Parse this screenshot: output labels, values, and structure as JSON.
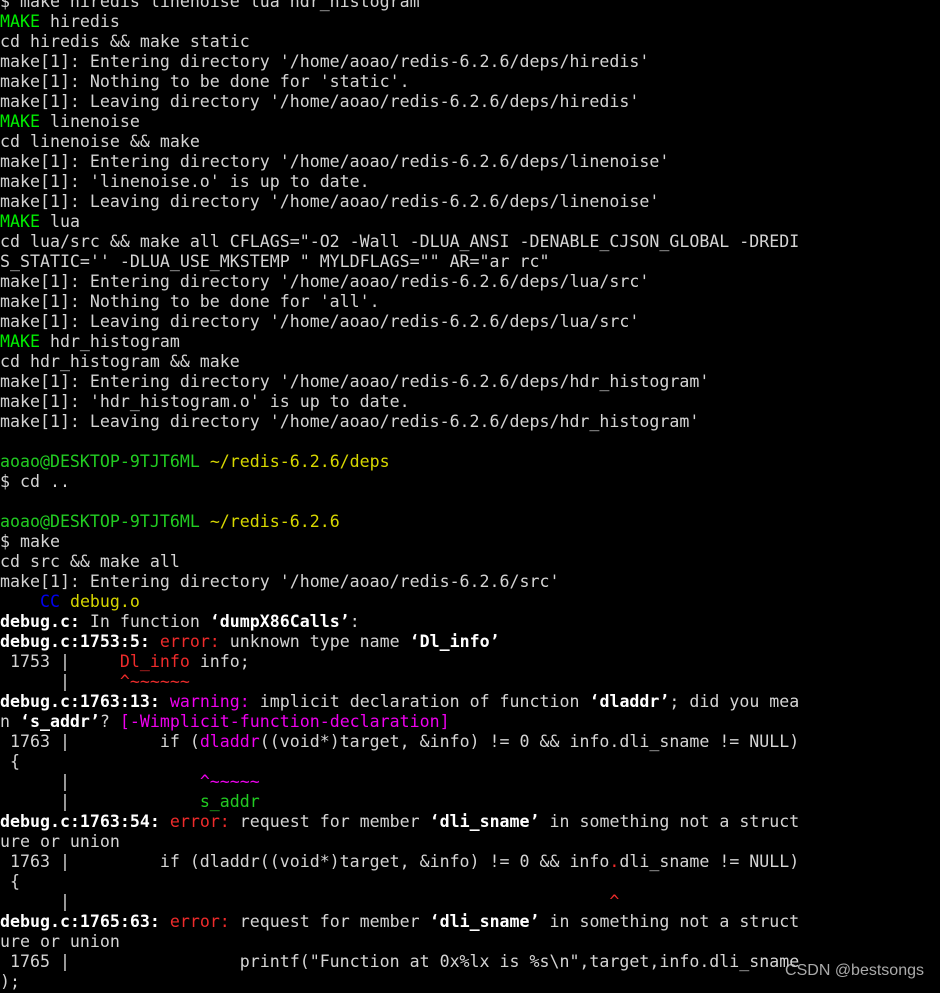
{
  "lines": [
    [
      {
        "t": "$ make hiredis linenoise lua hdr_histogram"
      }
    ],
    [
      {
        "t": "MAKE",
        "c": "g"
      },
      {
        "t": " hiredis"
      }
    ],
    [
      {
        "t": "cd hiredis && make static"
      }
    ],
    [
      {
        "t": "make[1]: Entering directory '/home/aoao/redis-6.2.6/deps/hiredis'"
      }
    ],
    [
      {
        "t": "make[1]: Nothing to be done for 'static'."
      }
    ],
    [
      {
        "t": "make[1]: Leaving directory '/home/aoao/redis-6.2.6/deps/hiredis'"
      }
    ],
    [
      {
        "t": "MAKE",
        "c": "g"
      },
      {
        "t": " linenoise"
      }
    ],
    [
      {
        "t": "cd linenoise && make"
      }
    ],
    [
      {
        "t": "make[1]: Entering directory '/home/aoao/redis-6.2.6/deps/linenoise'"
      }
    ],
    [
      {
        "t": "make[1]: 'linenoise.o' is up to date."
      }
    ],
    [
      {
        "t": "make[1]: Leaving directory '/home/aoao/redis-6.2.6/deps/linenoise'"
      }
    ],
    [
      {
        "t": "MAKE",
        "c": "g"
      },
      {
        "t": " lua"
      }
    ],
    [
      {
        "t": "cd lua/src && make all CFLAGS=\"-O2 -Wall -DLUA_ANSI -DENABLE_CJSON_GLOBAL -DREDI"
      }
    ],
    [
      {
        "t": "S_STATIC='' -DLUA_USE_MKSTEMP \" MYLDFLAGS=\"\" AR=\"ar rc\""
      }
    ],
    [
      {
        "t": "make[1]: Entering directory '/home/aoao/redis-6.2.6/deps/lua/src'"
      }
    ],
    [
      {
        "t": "make[1]: Nothing to be done for 'all'."
      }
    ],
    [
      {
        "t": "make[1]: Leaving directory '/home/aoao/redis-6.2.6/deps/lua/src'"
      }
    ],
    [
      {
        "t": "MAKE",
        "c": "g"
      },
      {
        "t": " hdr_histogram"
      }
    ],
    [
      {
        "t": "cd hdr_histogram && make"
      }
    ],
    [
      {
        "t": "make[1]: Entering directory '/home/aoao/redis-6.2.6/deps/hdr_histogram'"
      }
    ],
    [
      {
        "t": "make[1]: 'hdr_histogram.o' is up to date."
      }
    ],
    [
      {
        "t": "make[1]: Leaving directory '/home/aoao/redis-6.2.6/deps/hdr_histogram'"
      }
    ],
    [
      {
        "t": ""
      }
    ],
    [
      {
        "t": "aoao@DESKTOP-9TJT6ML",
        "c": "gr"
      },
      {
        "t": " "
      },
      {
        "t": "~/redis-6.2.6/deps",
        "c": "y"
      }
    ],
    [
      {
        "t": "$ cd .."
      }
    ],
    [
      {
        "t": ""
      }
    ],
    [
      {
        "t": "aoao@DESKTOP-9TJT6ML",
        "c": "gr"
      },
      {
        "t": " "
      },
      {
        "t": "~/redis-6.2.6",
        "c": "y"
      }
    ],
    [
      {
        "t": "$ make"
      }
    ],
    [
      {
        "t": "cd src && make all"
      }
    ],
    [
      {
        "t": "make[1]: Entering directory '/home/aoao/redis-6.2.6/src'"
      }
    ],
    [
      {
        "t": "    "
      },
      {
        "t": "CC",
        "c": "b"
      },
      {
        "t": " "
      },
      {
        "t": "debug.o",
        "c": "y"
      }
    ],
    [
      {
        "t": "debug.c:",
        "c": "bold"
      },
      {
        "t": " In function "
      },
      {
        "t": "‘dumpX86Calls’",
        "c": "bold"
      },
      {
        "t": ":"
      }
    ],
    [
      {
        "t": "debug.c:1753:5:",
        "c": "bold"
      },
      {
        "t": " "
      },
      {
        "t": "error:",
        "c": "r"
      },
      {
        "t": " unknown type name "
      },
      {
        "t": "‘Dl_info’",
        "c": "bold"
      }
    ],
    [
      {
        "t": " 1753 |     "
      },
      {
        "t": "Dl_info",
        "c": "r"
      },
      {
        "t": " info;"
      }
    ],
    [
      {
        "t": "      |     "
      },
      {
        "t": "^~~~~~~",
        "c": "r"
      }
    ],
    [
      {
        "t": "debug.c:1763:13:",
        "c": "bold"
      },
      {
        "t": " "
      },
      {
        "t": "warning:",
        "c": "m"
      },
      {
        "t": " implicit declaration of function "
      },
      {
        "t": "‘dladdr’",
        "c": "bold"
      },
      {
        "t": "; did you mea"
      }
    ],
    [
      {
        "t": "n "
      },
      {
        "t": "‘s_addr’",
        "c": "bold"
      },
      {
        "t": "? "
      },
      {
        "t": "[-Wimplicit-function-declaration]",
        "c": "m"
      }
    ],
    [
      {
        "t": " 1763 |         if ("
      },
      {
        "t": "dladdr",
        "c": "m"
      },
      {
        "t": "((void*)target, &info) != 0 && info.dli_sname != NULL)"
      }
    ],
    [
      {
        "t": " {"
      }
    ],
    [
      {
        "t": "      |             "
      },
      {
        "t": "^~~~~~",
        "c": "m"
      }
    ],
    [
      {
        "t": "      |             "
      },
      {
        "t": "s_addr",
        "c": "gr"
      }
    ],
    [
      {
        "t": "debug.c:1763:54:",
        "c": "bold"
      },
      {
        "t": " "
      },
      {
        "t": "error:",
        "c": "r"
      },
      {
        "t": " request for member "
      },
      {
        "t": "‘dli_sname’",
        "c": "bold"
      },
      {
        "t": " in something not a struct"
      }
    ],
    [
      {
        "t": "ure or union"
      }
    ],
    [
      {
        "t": " 1763 |         if (dladdr((void*)target, &info) != 0 && info"
      },
      {
        "t": ".",
        "c": "r"
      },
      {
        "t": "dli_sname != NULL)"
      }
    ],
    [
      {
        "t": " {"
      }
    ],
    [
      {
        "t": "      |                                                      "
      },
      {
        "t": "^",
        "c": "r"
      }
    ],
    [
      {
        "t": "debug.c:1765:63:",
        "c": "bold"
      },
      {
        "t": " "
      },
      {
        "t": "error:",
        "c": "r"
      },
      {
        "t": " request for member "
      },
      {
        "t": "‘dli_sname’",
        "c": "bold"
      },
      {
        "t": " in something not a struct"
      }
    ],
    [
      {
        "t": "ure or union"
      }
    ],
    [
      {
        "t": " 1765 |                 printf(\"Function at 0x%lx is %s\\n\",target,info.dli_sname"
      }
    ],
    [
      {
        "t": ");"
      }
    ]
  ],
  "watermark": "CSDN @bestsongs"
}
